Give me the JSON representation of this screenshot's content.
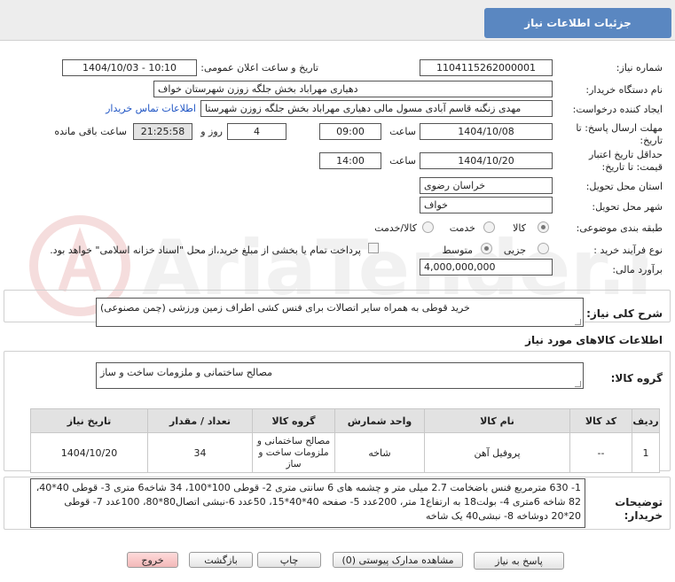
{
  "header": {
    "title": "جزئیات اطلاعات نیاز"
  },
  "form": {
    "need_number_label": "شماره نیاز:",
    "need_number": "1104115262000001",
    "announce_label": "تاریخ و ساعت اعلان عمومی:",
    "announce_value": "1404/10/03 - 10:10",
    "buyer_org_label": "نام دستگاه خریدار:",
    "buyer_org": "دهیاری مهراباد بخش جلگه زوزن شهرستان خواف",
    "creator_label": "ایجاد کننده درخواست:",
    "creator": "مهدی زنگنه قاسم آبادی مسول مالی دهیاری مهراباد بخش جلگه زوزن شهرستا",
    "contact_link": "اطلاعات تماس خریدار",
    "reply_deadline_label": "مهلت ارسال پاسخ: تا تاریخ:",
    "reply_date": "1404/10/08",
    "time_label": "ساعت",
    "reply_time": "09:00",
    "days_value": "4",
    "days_label": "روز و",
    "remaining_value": "21:25:58",
    "remaining_label": "ساعت باقی مانده",
    "price_validity_label": "حداقل تاریخ اعتبار قیمت: تا تاریخ:",
    "validity_date": "1404/10/20",
    "validity_time_label": "ساعت",
    "validity_time": "14:00",
    "province_label": "استان محل تحویل:",
    "province": "خراسان رضوی",
    "city_label": "شهر محل تحویل:",
    "city": "خواف",
    "category_label": "طبقه بندی موضوعی:",
    "category_options": [
      "کالا",
      "خدمت",
      "کالا/خدمت"
    ],
    "category_selected": "کالا",
    "process_label": "نوع فرآیند خرید :",
    "process_options": [
      "جزیی",
      "متوسط"
    ],
    "process_selected": "متوسط",
    "payment_note": "پرداخت تمام یا بخشی از مبلغ خرید،از محل \"اسناد خزانه اسلامی\" خواهد بود.",
    "budget_label": "برآورد مالی:",
    "budget": "4,000,000,000"
  },
  "summary": {
    "label": "شرح کلی نیاز:",
    "text": "خرید قوطی به همراه سایر اتصالات برای فنس کشی اطراف زمین ورزشی (چمن مصنوعی)"
  },
  "goods": {
    "section_title": "اطلاعات کالاهای مورد نیاز",
    "group_label": "گروه کالا:",
    "group_value": "مصالح ساختمانی و ملزومات ساخت و ساز",
    "columns": [
      "ردیف",
      "کد کالا",
      "نام کالا",
      "واحد شمارش",
      "گروه کالا",
      "تعداد / مقدار",
      "تاریخ نیاز"
    ],
    "rows": [
      {
        "index": "1",
        "code": "--",
        "name": "پروفیل آهن",
        "unit": "شاخه",
        "group": "مصالح ساختمانی و ملزومات ساخت و ساز",
        "qty": "34",
        "date": "1404/10/20"
      }
    ]
  },
  "buyer_notes": {
    "label": "توضیحات خریدار:",
    "text": "1- 630  مترمربع فنس باضخامت 2.7 میلی متر و چشمه های 6 سانتی متری 2- قوطی 100*100، 34 شاخه6 متری 3- قوطی 40*40، 82 شاخه 6متری 4- بولت18 به ارتفاع1 متر، 200عدد 5- صفحه 40*40*15، 50عدد 6-نبشی اتصال80*80، 100عدد 7- قوطی 20*20 دوشاخه 8- نبشی40 یک شاخه"
  },
  "buttons": {
    "reply": "پاسخ به نیاز",
    "attachments": "مشاهده مدارک پیوستی (0)",
    "print": "چاپ",
    "back": "بازگشت",
    "exit": "خروج"
  },
  "watermark": {
    "text": "AriaTender.neT"
  }
}
